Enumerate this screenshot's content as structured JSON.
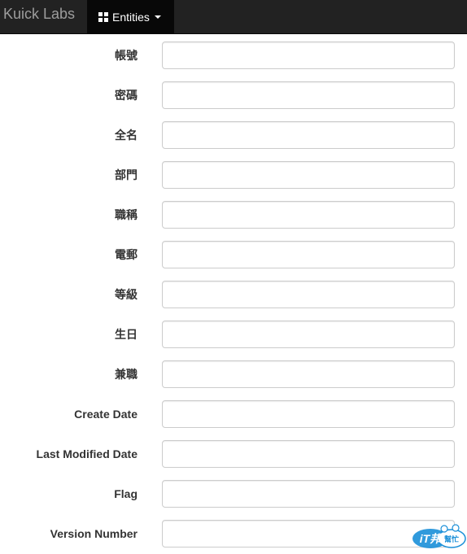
{
  "navbar": {
    "brand": "Kuick Labs",
    "entities_label": "Entities"
  },
  "form": {
    "fields": [
      {
        "label": "帳號",
        "value": ""
      },
      {
        "label": "密碼",
        "value": ""
      },
      {
        "label": "全名",
        "value": ""
      },
      {
        "label": "部門",
        "value": ""
      },
      {
        "label": "職稱",
        "value": ""
      },
      {
        "label": "電郵",
        "value": ""
      },
      {
        "label": "等級",
        "value": ""
      },
      {
        "label": "生日",
        "value": ""
      },
      {
        "label": "兼職",
        "value": ""
      },
      {
        "label": "Create Date",
        "value": ""
      },
      {
        "label": "Last Modified Date",
        "value": ""
      },
      {
        "label": "Flag",
        "value": ""
      },
      {
        "label": "Version Number",
        "value": ""
      }
    ]
  },
  "watermark": {
    "text": "iT邦幫忙",
    "color": "#1a8fd8"
  }
}
